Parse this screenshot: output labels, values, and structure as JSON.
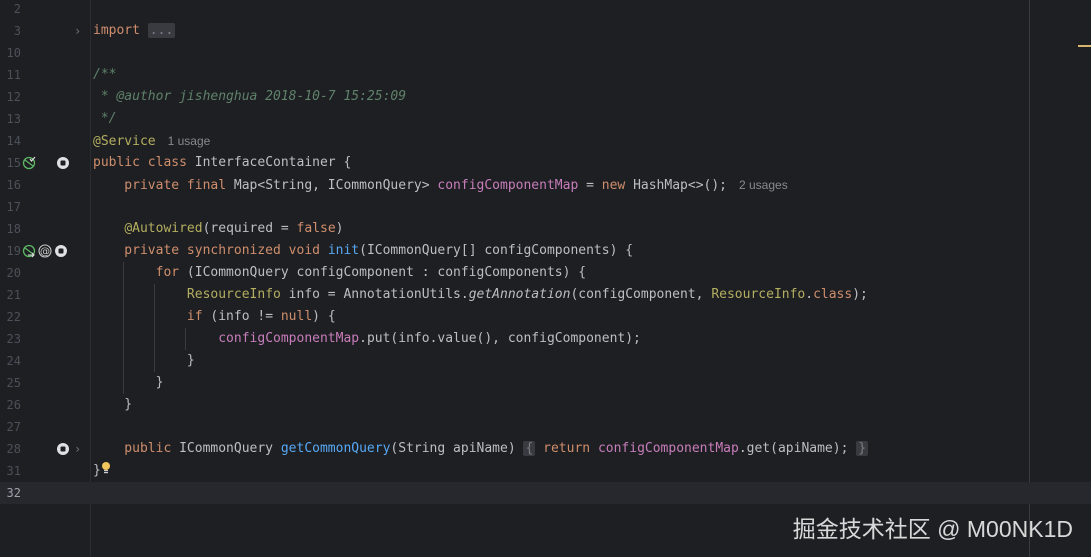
{
  "editor": {
    "lines": [
      {
        "n": "2",
        "t": []
      },
      {
        "n": "3",
        "fold": true,
        "t": [
          [
            "import",
            "kw"
          ],
          [
            " ",
            ""
          ],
          [
            "...",
            "fd"
          ]
        ]
      },
      {
        "n": "10",
        "t": []
      },
      {
        "n": "11",
        "t": [
          [
            "/**",
            "doc"
          ]
        ]
      },
      {
        "n": "12",
        "t": [
          [
            " * @author jishenghua 2018-10-7 15:25:09",
            "doc"
          ]
        ]
      },
      {
        "n": "13",
        "t": [
          [
            " */",
            "doc"
          ]
        ]
      },
      {
        "n": "14",
        "t": [
          [
            "@Service",
            "ann"
          ]
        ],
        "hint": "1 usage"
      },
      {
        "n": "15",
        "icons": [
          "bean-icon",
          "implemented-icon"
        ],
        "t": [
          [
            "public class ",
            "kw"
          ],
          [
            "InterfaceContainer {",
            ""
          ]
        ]
      },
      {
        "n": "16",
        "t": [
          [
            "    private final ",
            "kw"
          ],
          [
            "Map<String, ICommonQuery> ",
            ""
          ],
          [
            "configComponentMap",
            "fld"
          ],
          [
            " = ",
            ""
          ],
          [
            "new ",
            "kw"
          ],
          [
            "HashMap<>();",
            ""
          ]
        ],
        "hint": "2 usages"
      },
      {
        "n": "17",
        "t": []
      },
      {
        "n": "18",
        "t": [
          [
            "    ",
            ""
          ],
          [
            "@Autowired",
            "ann"
          ],
          [
            "(required = ",
            ""
          ],
          [
            "false",
            "kw"
          ],
          [
            ")",
            ""
          ]
        ]
      },
      {
        "n": "19",
        "icons": [
          "bean-injection-icon",
          "at-icon",
          "implemented-icon"
        ],
        "t": [
          [
            "    private synchronized void ",
            "kw"
          ],
          [
            "init",
            "fn"
          ],
          [
            "(ICommonQuery[] configComponents) {",
            ""
          ]
        ]
      },
      {
        "n": "20",
        "t": [
          [
            "        for ",
            "kw"
          ],
          [
            "(ICommonQuery configComponent : configComponents) {",
            ""
          ]
        ]
      },
      {
        "n": "21",
        "t": [
          [
            "            ",
            ""
          ],
          [
            "ResourceInfo",
            "ann"
          ],
          [
            " info = AnnotationUtils.",
            ""
          ],
          [
            "getAnnotation",
            "fnc"
          ],
          [
            "(configComponent, ",
            ""
          ],
          [
            "ResourceInfo",
            "ann"
          ],
          [
            ".",
            ""
          ],
          [
            "class",
            "kw"
          ],
          [
            ");",
            ""
          ]
        ]
      },
      {
        "n": "22",
        "t": [
          [
            "            if ",
            "kw"
          ],
          [
            "(info != ",
            ""
          ],
          [
            "null",
            "kw"
          ],
          [
            ") {",
            ""
          ]
        ]
      },
      {
        "n": "23",
        "t": [
          [
            "                ",
            ""
          ],
          [
            "configComponentMap",
            "fld"
          ],
          [
            ".put(info.value(), configComponent);",
            ""
          ]
        ]
      },
      {
        "n": "24",
        "t": [
          [
            "            }",
            ""
          ]
        ]
      },
      {
        "n": "25",
        "t": [
          [
            "        }",
            ""
          ]
        ]
      },
      {
        "n": "26",
        "t": [
          [
            "    }",
            ""
          ]
        ]
      },
      {
        "n": "27",
        "t": []
      },
      {
        "n": "28",
        "icons": [
          "implemented-icon"
        ],
        "fold": true,
        "t": [
          [
            "    public ",
            "kw"
          ],
          [
            "ICommonQuery ",
            ""
          ],
          [
            "getCommonQuery",
            "fn"
          ],
          [
            "(String apiName) ",
            ""
          ],
          [
            "{",
            "fd"
          ],
          [
            " ",
            ""
          ],
          [
            "return ",
            "kw"
          ],
          [
            "configComponentMap",
            "fld"
          ],
          [
            ".get(apiName); ",
            ""
          ],
          [
            "}",
            "fd"
          ]
        ]
      },
      {
        "n": "31",
        "bulb": true,
        "t": [
          [
            "}",
            ""
          ]
        ]
      },
      {
        "n": "32",
        "current": true,
        "t": []
      }
    ]
  },
  "watermark": "掘金技术社区 @ M00NK1D"
}
